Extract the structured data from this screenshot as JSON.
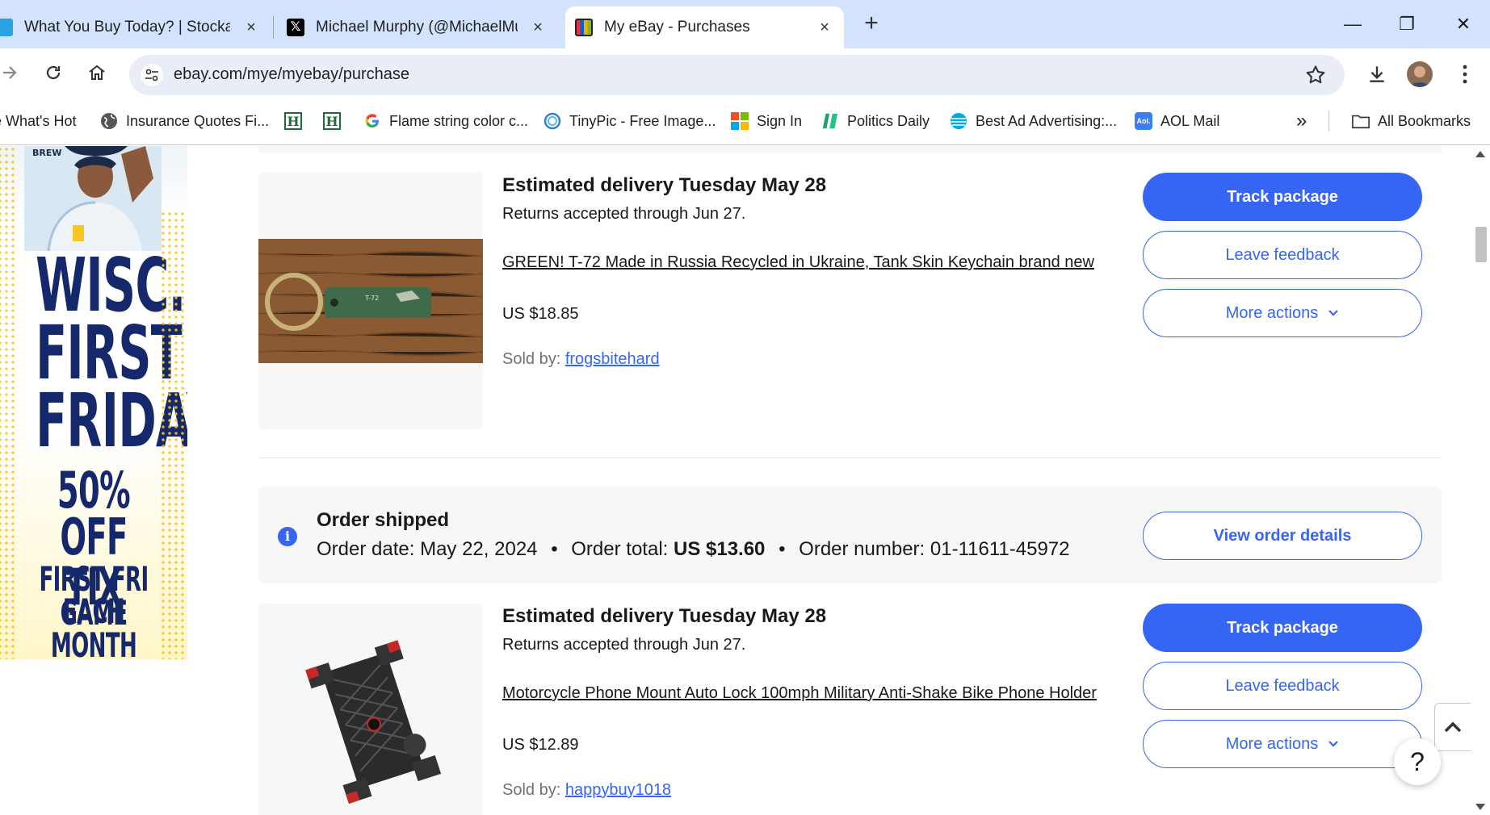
{
  "browser": {
    "tabs": [
      {
        "title": "What You Buy Today? | Stockahe",
        "close": "×"
      },
      {
        "title": "Michael Murphy (@MichaelMur",
        "close": "×"
      },
      {
        "title": "My eBay - Purchases",
        "close": "×"
      }
    ],
    "new_tab": "+",
    "window_controls": {
      "minimize": "—",
      "restore": "❐",
      "close": "✕"
    },
    "url": "ebay.com/mye/myebay/purchase",
    "bookmarks": [
      {
        "label": "e What's Hot",
        "icon": "page-icon"
      },
      {
        "label": "Insurance Quotes Fi...",
        "icon": "globe-icon"
      },
      {
        "label": "",
        "icon": "h-icon"
      },
      {
        "label": "",
        "icon": "h-icon"
      },
      {
        "label": "Flame string color c...",
        "icon": "google-icon"
      },
      {
        "label": "TinyPic - Free Image...",
        "icon": "tinypic-icon"
      },
      {
        "label": "Sign In",
        "icon": "microsoft-icon"
      },
      {
        "label": "Politics Daily",
        "icon": "politics-icon"
      },
      {
        "label": "Best Ad Advertising:...",
        "icon": "att-icon"
      },
      {
        "label": "AOL Mail",
        "icon": "aol-icon"
      }
    ],
    "bookmark_h": "H",
    "aol_badge": "Aol.",
    "more_bookmarks": "»",
    "all_bookmarks": "All Bookmarks"
  },
  "ad": {
    "lines": [
      "WISC.",
      "FIRST",
      "FRIDAYS",
      "50%",
      "OFF TIX",
      "FIRST FRI GAME",
      "EACH MONTH"
    ],
    "jersey": "BREW"
  },
  "items": [
    {
      "estimated_delivery": "Estimated delivery Tuesday May 28",
      "returns": "Returns accepted through Jun 27.",
      "title": "GREEN! T-72 Made in Russia Recycled in Ukraine, Tank Skin Keychain brand new",
      "price": "US $18.85",
      "sold_by_label": "Sold by:",
      "seller": "frogsbitehard",
      "tag_text": "T-72",
      "buttons": {
        "track": "Track package",
        "feedback": "Leave feedback",
        "more": "More actions"
      }
    },
    {
      "estimated_delivery": "Estimated delivery Tuesday May 28",
      "returns": "Returns accepted through Jun 27.",
      "title": "Motorcycle Phone Mount Auto Lock 100mph Military Anti-Shake Bike Phone Holder",
      "price": "US $12.89",
      "sold_by_label": "Sold by:",
      "seller": "happybuy1018",
      "buttons": {
        "track": "Track package",
        "feedback": "Leave feedback",
        "more": "More actions"
      }
    }
  ],
  "order": {
    "status": "Order shipped",
    "date_label": "Order date:",
    "date": "May 22, 2024",
    "total_label": "Order total:",
    "total": "US $13.60",
    "number_label": "Order number:",
    "number": "01-11611-45972",
    "separator": "•",
    "info_glyph": "i",
    "view_details": "View order details"
  },
  "help_label": "?",
  "colors": {
    "ebay_blue": "#3665f3",
    "tabstrip": "#d3e3fd",
    "text": "#191919",
    "muted": "#707070",
    "panel": "#f7f7f7",
    "ad_navy": "#14286b",
    "ad_gold": "#f6c623"
  }
}
